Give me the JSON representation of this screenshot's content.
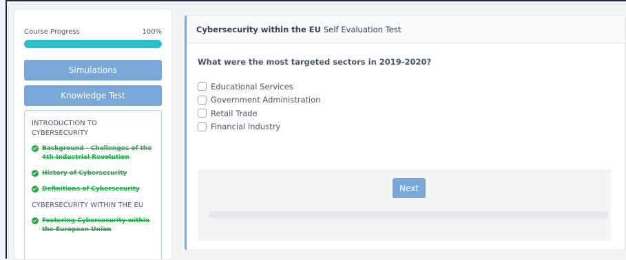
{
  "sidebar": {
    "progress_label": "Course Progress",
    "progress_value": "100%",
    "progress_fraction": 1.0,
    "simulations_label": "Simulations",
    "knowledge_test_label": "Knowledge Test",
    "toc": {
      "section1": "INTRODUCTION TO CYBERSECURITY",
      "items1": [
        "Background - Challenges of the 4th Industrial Revolution",
        "History of Cybersecurity",
        "Definitions of Cybersecurity"
      ],
      "section2": "CYBERSECURITY WITHIN THE EU",
      "items2": [
        "Fostering Cybersecurity within the European Union"
      ]
    }
  },
  "main": {
    "header_bold": "Cybersecurity within the EU",
    "header_rest": "Self Evaluation Test",
    "question": "What were the most targeted sectors in 2019-2020?",
    "options": [
      "Educational Services",
      "Government Administration",
      "Retail Trade",
      "Financial industry"
    ],
    "next_label": "Next"
  },
  "colors": {
    "accent_button": "#78a7d8",
    "progress_fill": "#2bbfc9",
    "completed_green": "#22a845"
  }
}
